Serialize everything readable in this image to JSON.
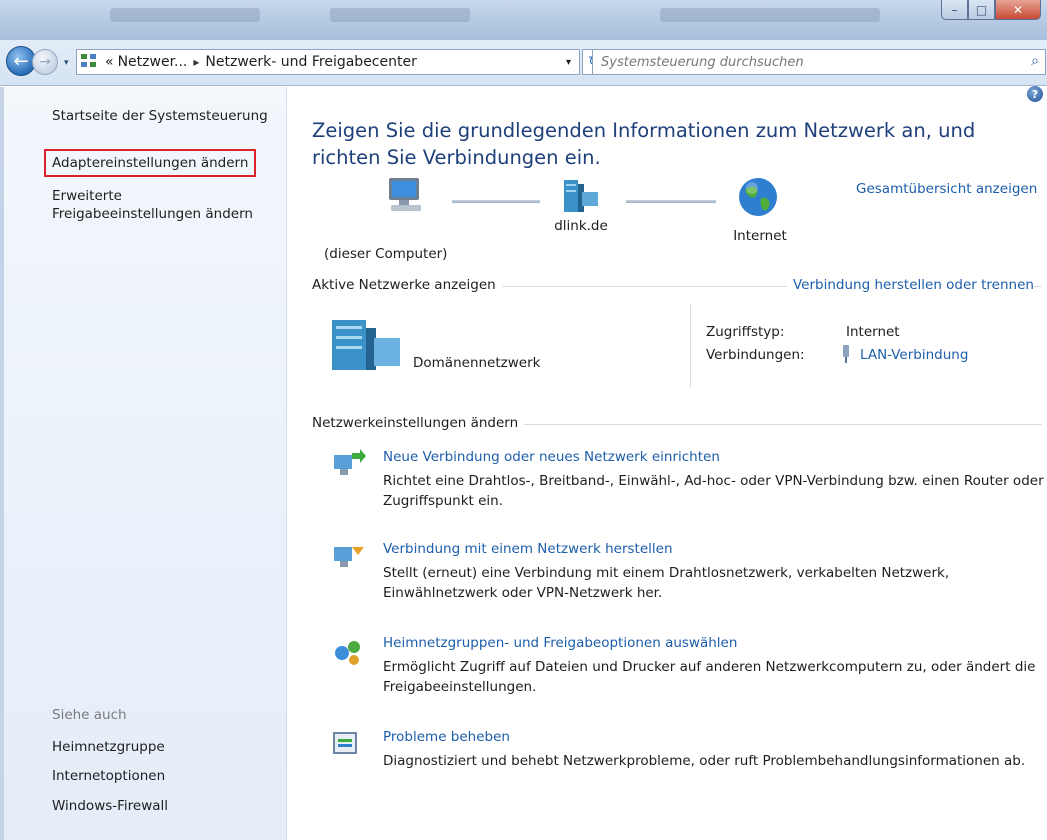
{
  "window": {
    "controls": {
      "minimize": "–",
      "maximize": "□",
      "close": "✕"
    }
  },
  "nav": {
    "back_icon": "back-arrow-icon",
    "forward_icon": "forward-arrow-icon"
  },
  "address": {
    "prefix": "«",
    "segment1": "Netzwer...",
    "separator": "▸",
    "segment2": "Netzwerk- und Freigabecenter",
    "dropdown": "▾",
    "refresh": "↻"
  },
  "search": {
    "placeholder": "Systemsteuerung durchsuchen",
    "icon": "search-icon"
  },
  "sidebar": {
    "home": "Startseite der Systemsteuerung",
    "adapter": "Adaptereinstellungen ändern",
    "advanced_line1": "Erweiterte",
    "advanced_line2": "Freigabeeinstellungen ändern",
    "see_also": "Siehe auch",
    "links": [
      "Heimnetzgruppe",
      "Internetoptionen",
      "Windows-Firewall"
    ]
  },
  "main": {
    "help": "?",
    "heading": "Zeigen Sie die grundlegenden Informationen zum Netzwerk an, und richten Sie Verbindungen ein.",
    "map": {
      "computer": "(dieser Computer)",
      "router": "dlink.de",
      "internet": "Internet",
      "full_map": "Gesamtübersicht anzeigen"
    },
    "active": {
      "label": "Aktive Netzwerke anzeigen",
      "connect_link": "Verbindung herstellen oder trennen",
      "network_name": "Domänennetzwerk",
      "access_type_label": "Zugriffstyp:",
      "access_type_value": "Internet",
      "connections_label": "Verbindungen:",
      "connections_value": "LAN-Verbindung"
    },
    "settings": {
      "label": "Netzwerkeinstellungen ändern",
      "tasks": [
        {
          "title": "Neue Verbindung oder neues Netzwerk einrichten",
          "desc": "Richtet eine Drahtlos-, Breitband-, Einwähl-, Ad-hoc- oder VPN-Verbindung bzw. einen Router oder Zugriffspunkt ein."
        },
        {
          "title": "Verbindung mit einem Netzwerk herstellen",
          "desc": "Stellt (erneut) eine Verbindung mit einem Drahtlosnetzwerk, verkabelten Netzwerk, Einwählnetzwerk oder VPN-Netzwerk her."
        },
        {
          "title": "Heimnetzgruppen- und Freigabeoptionen auswählen",
          "desc": "Ermöglicht Zugriff auf Dateien und Drucker auf anderen Netzwerkcomputern zu, oder ändert die Freigabeeinstellungen."
        },
        {
          "title": "Probleme beheben",
          "desc": "Diagnostiziert und behebt Netzwerkprobleme, oder ruft Problembehandlungsinformationen ab."
        }
      ]
    }
  },
  "colors": {
    "link": "#1d5eab",
    "heading": "#1e3f7a",
    "highlight": "#d9222a"
  }
}
